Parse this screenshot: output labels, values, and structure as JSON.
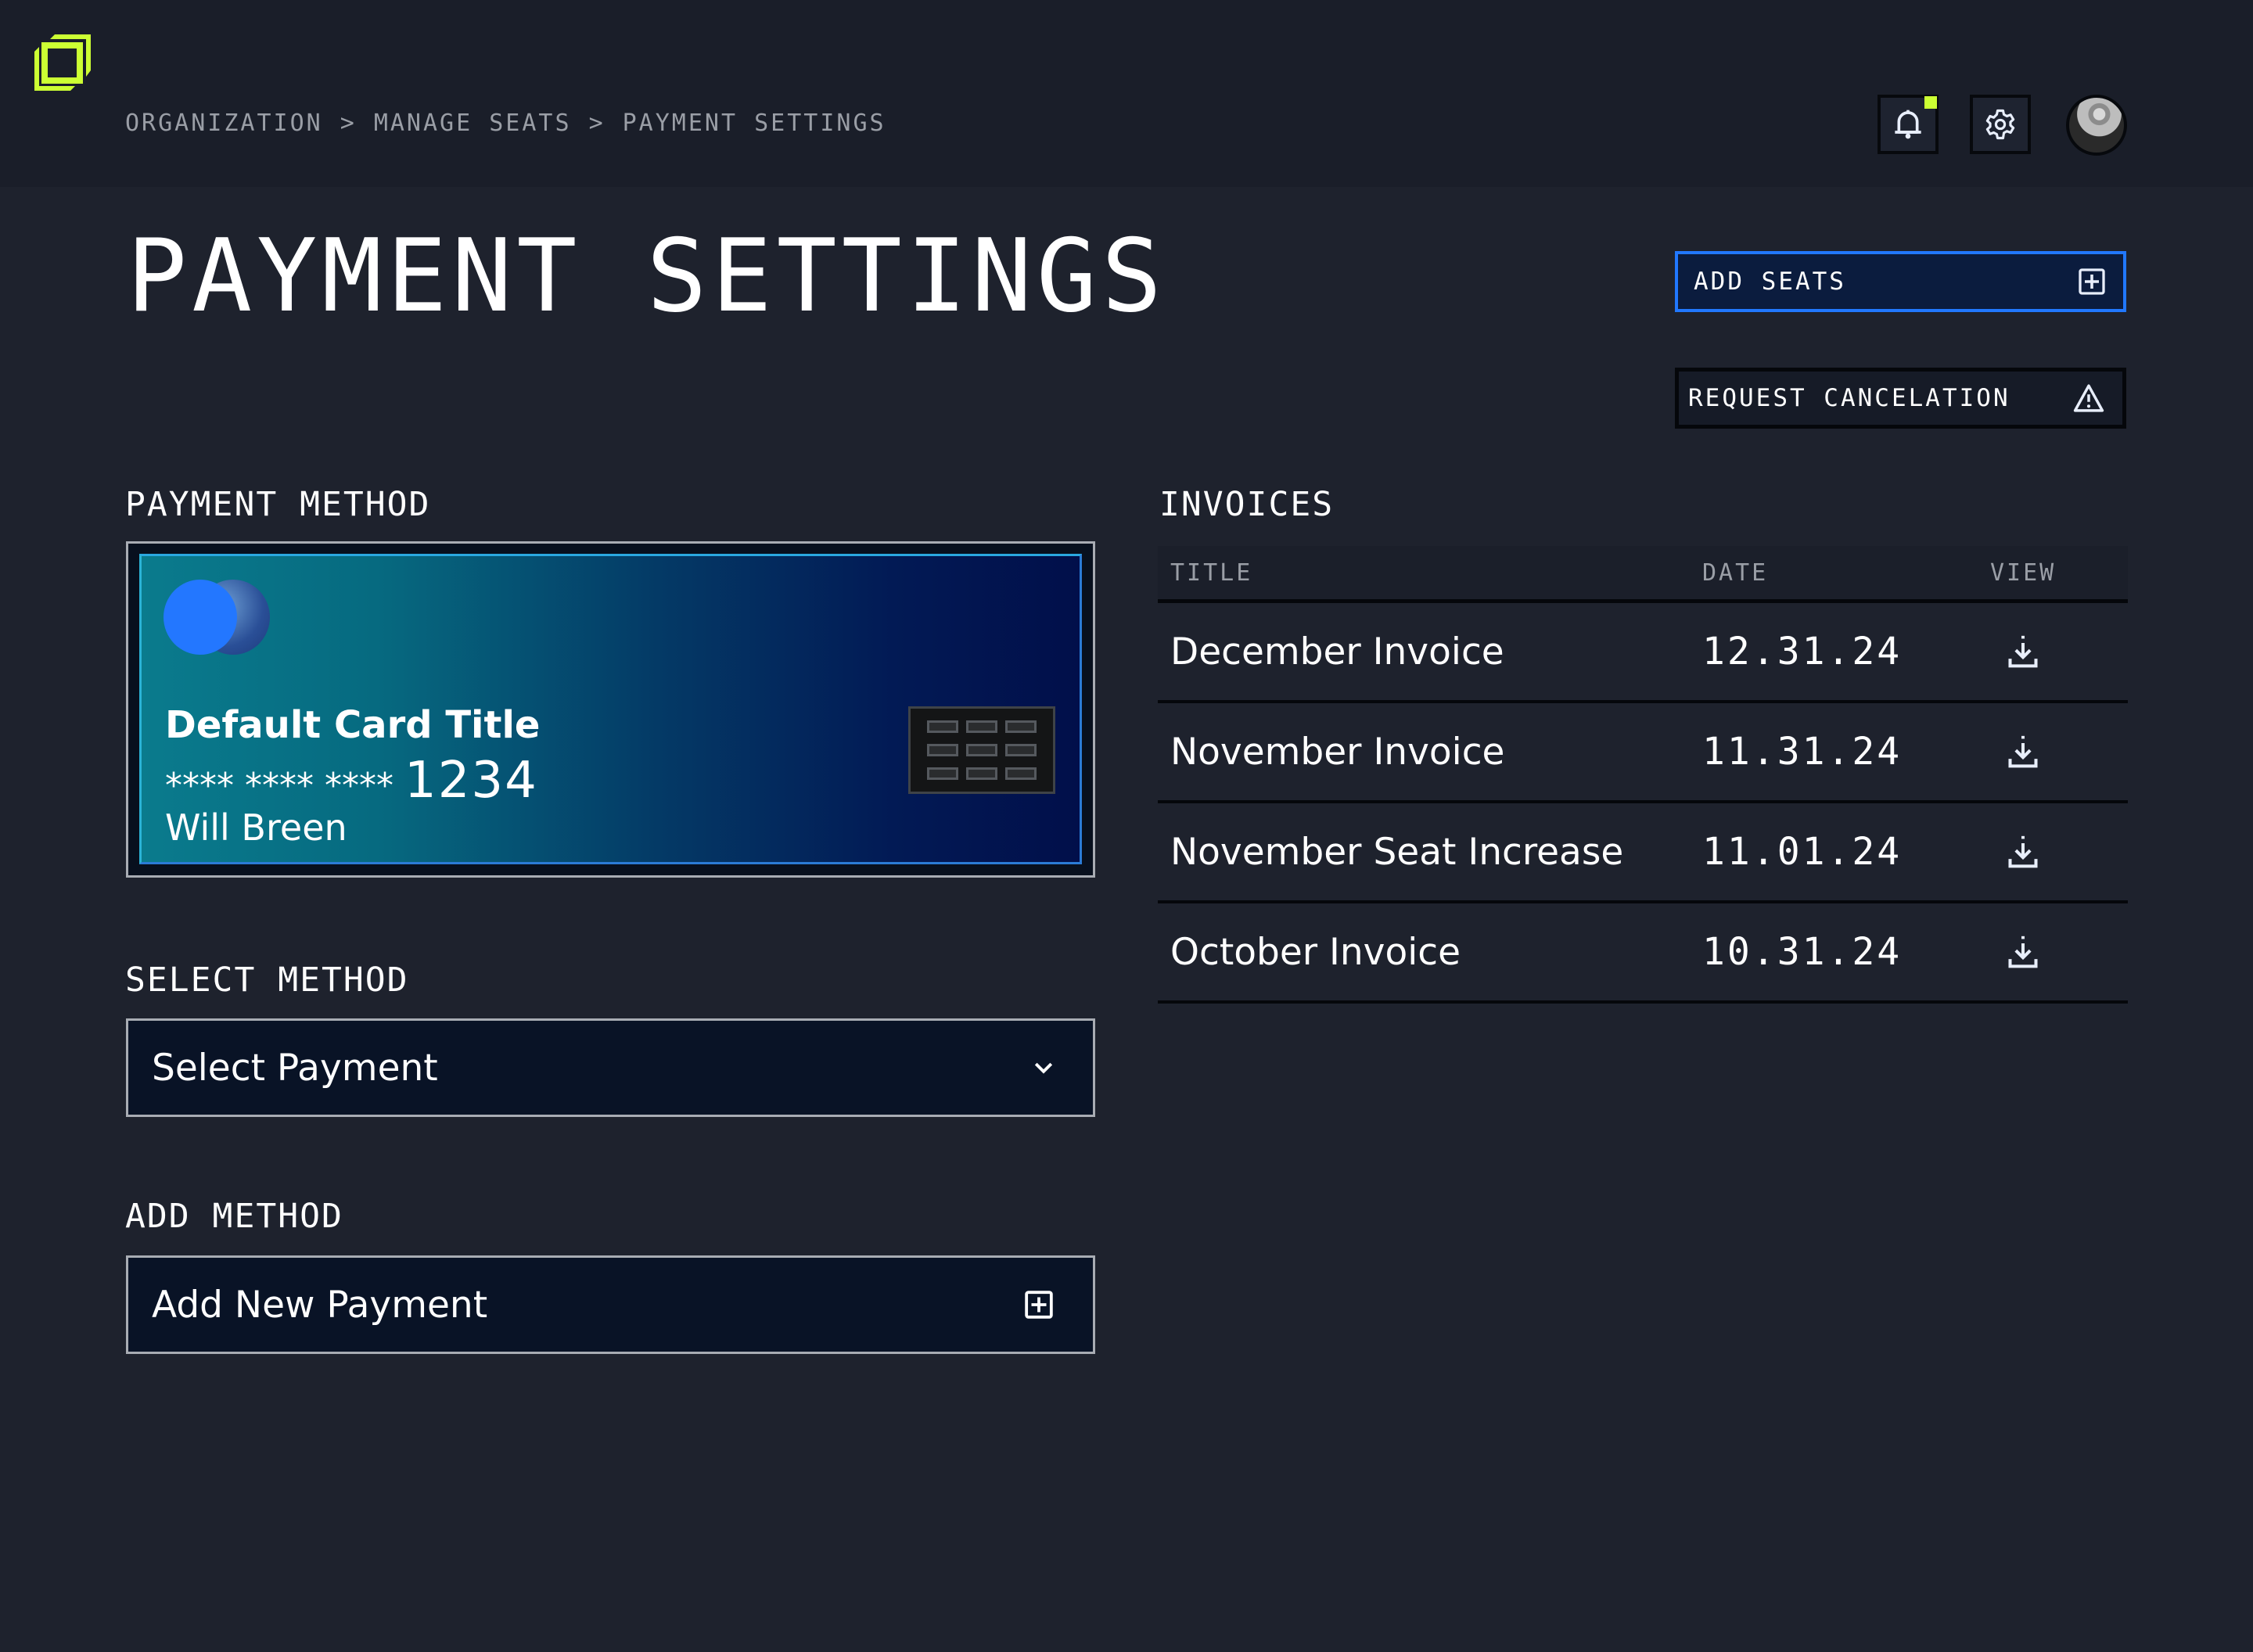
{
  "app": {
    "logo_icon": "nested-squares-logo",
    "brand_color": "#ccff33",
    "accent_color": "#2178ff"
  },
  "breadcrumb": [
    "ORGANIZATION",
    "MANAGE SEATS",
    "PAYMENT SETTINGS"
  ],
  "breadcrumb_separator": ">",
  "header": {
    "notifications_icon": "bell-icon",
    "notifications_has_unread": true,
    "settings_icon": "gear-icon",
    "avatar_label": "user-avatar"
  },
  "page": {
    "title": "PAYMENT SETTINGS",
    "actions": {
      "add_seats_label": "ADD SEATS",
      "add_seats_icon": "plus-square-icon",
      "cancel_label": "REQUEST CANCELATION",
      "cancel_icon": "warning-triangle-icon"
    }
  },
  "payment_method": {
    "label": "PAYMENT METHOD",
    "card": {
      "title": "Default Card Title",
      "masked_number": "**** **** ****",
      "last4": "1234",
      "holder": "Will Breen"
    }
  },
  "select_method": {
    "label": "SELECT METHOD",
    "placeholder": "Select Payment"
  },
  "add_method": {
    "label": "ADD METHOD",
    "button_label": "Add New Payment"
  },
  "invoices": {
    "label": "INVOICES",
    "columns": [
      "TITLE",
      "DATE",
      "VIEW"
    ],
    "rows": [
      {
        "title": "December Invoice",
        "date": "12.31.24",
        "view_icon": "download-icon"
      },
      {
        "title": "November Invoice",
        "date": "11.31.24",
        "view_icon": "download-icon"
      },
      {
        "title": "November Seat Increase",
        "date": "11.01.24",
        "view_icon": "download-icon"
      },
      {
        "title": "October Invoice",
        "date": "10.31.24",
        "view_icon": "download-icon"
      }
    ]
  }
}
